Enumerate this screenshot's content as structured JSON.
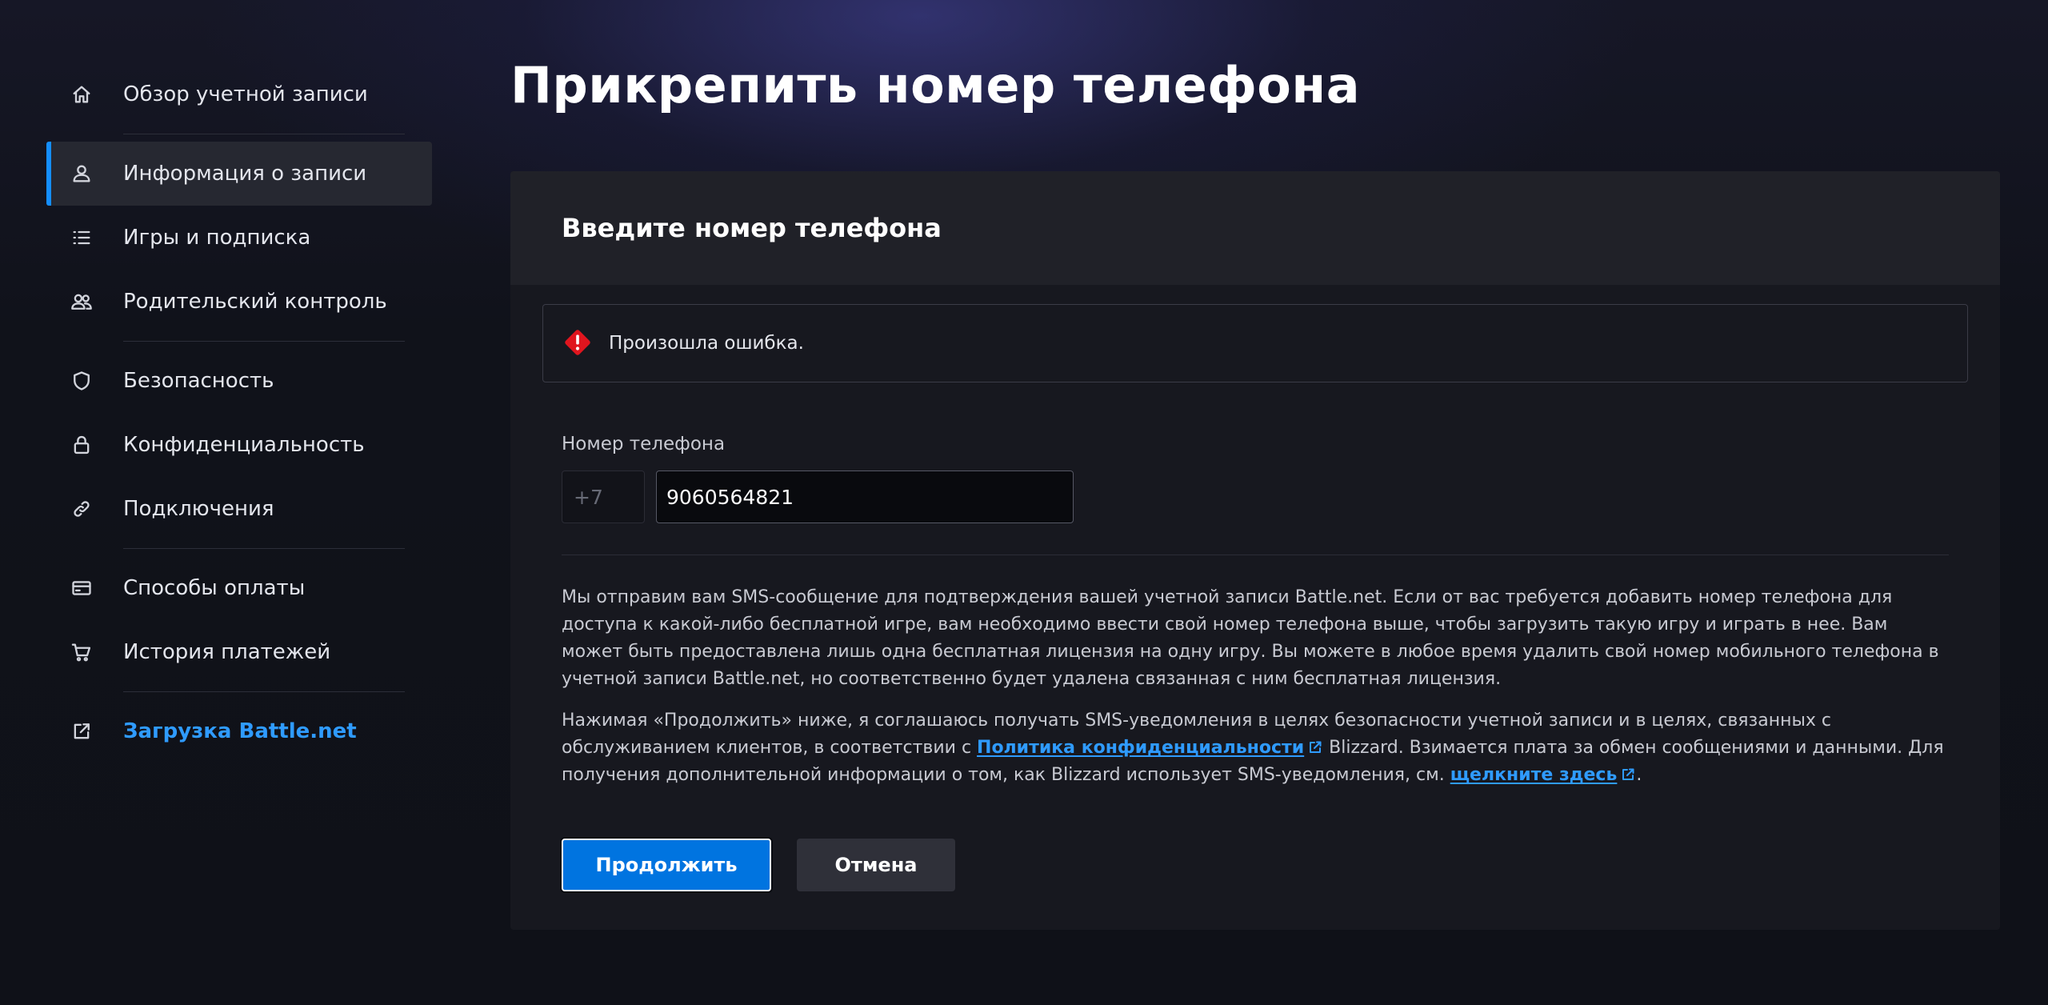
{
  "sidebar": {
    "items": [
      {
        "label": "Обзор учетной записи",
        "icon": "home-icon"
      },
      {
        "label": "Информация о записи",
        "icon": "user-icon",
        "active": true
      },
      {
        "label": "Игры и подписка",
        "icon": "list-icon"
      },
      {
        "label": "Родительский контроль",
        "icon": "users-icon"
      },
      {
        "label": "Безопасность",
        "icon": "shield-icon"
      },
      {
        "label": "Конфиденциальность",
        "icon": "lock-icon"
      },
      {
        "label": "Подключения",
        "icon": "link-icon"
      },
      {
        "label": "Способы оплаты",
        "icon": "credit-card-icon"
      },
      {
        "label": "История платежей",
        "icon": "cart-icon"
      },
      {
        "label": "Загрузка Battle.net",
        "icon": "external-link-icon"
      }
    ]
  },
  "page": {
    "title": "Прикрепить номер телефона"
  },
  "card": {
    "title": "Введите номер телефона",
    "error": "Произошла ошибка.",
    "phone_label": "Номер телефона",
    "country_code": "+7",
    "phone_value": "9060564821",
    "info_paragraph": "Мы отправим вам SMS-сообщение для подтверждения вашей учетной записи Battle.net. Если от вас требуется добавить номер телефона для доступа к какой-либо бесплатной игре, вам необходимо ввести свой номер телефона выше, чтобы загрузить такую игру и играть в нее. Вам может быть предоставлена лишь одна бесплатная лицензия на одну игру. Вы можете в любое время удалить свой номер мобильного телефона в учетной записи Battle.net, но соответственно будет удалена связанная с ним бесплатная лицензия.",
    "consent": {
      "part1": "Нажимая «Продолжить» ниже, я соглашаюсь получать SMS-уведомления в целях безопасности учетной записи и в целях, связанных с обслуживанием клиентов, в соответствии с ",
      "privacy_link": "Политика конфиденциальности",
      "part2": " Blizzard. Взимается плата за обмен сообщениями и данными. Для получения дополнительной информации о том, как Blizzard использует SMS-уведомления, см. ",
      "here_link": "щелкните здесь",
      "part3": "."
    },
    "continue_label": "Продолжить",
    "cancel_label": "Отмена"
  },
  "colors": {
    "accent": "#148eff",
    "link": "#2f9bff",
    "primary_button": "#0074e0",
    "error": "#e0151e"
  }
}
